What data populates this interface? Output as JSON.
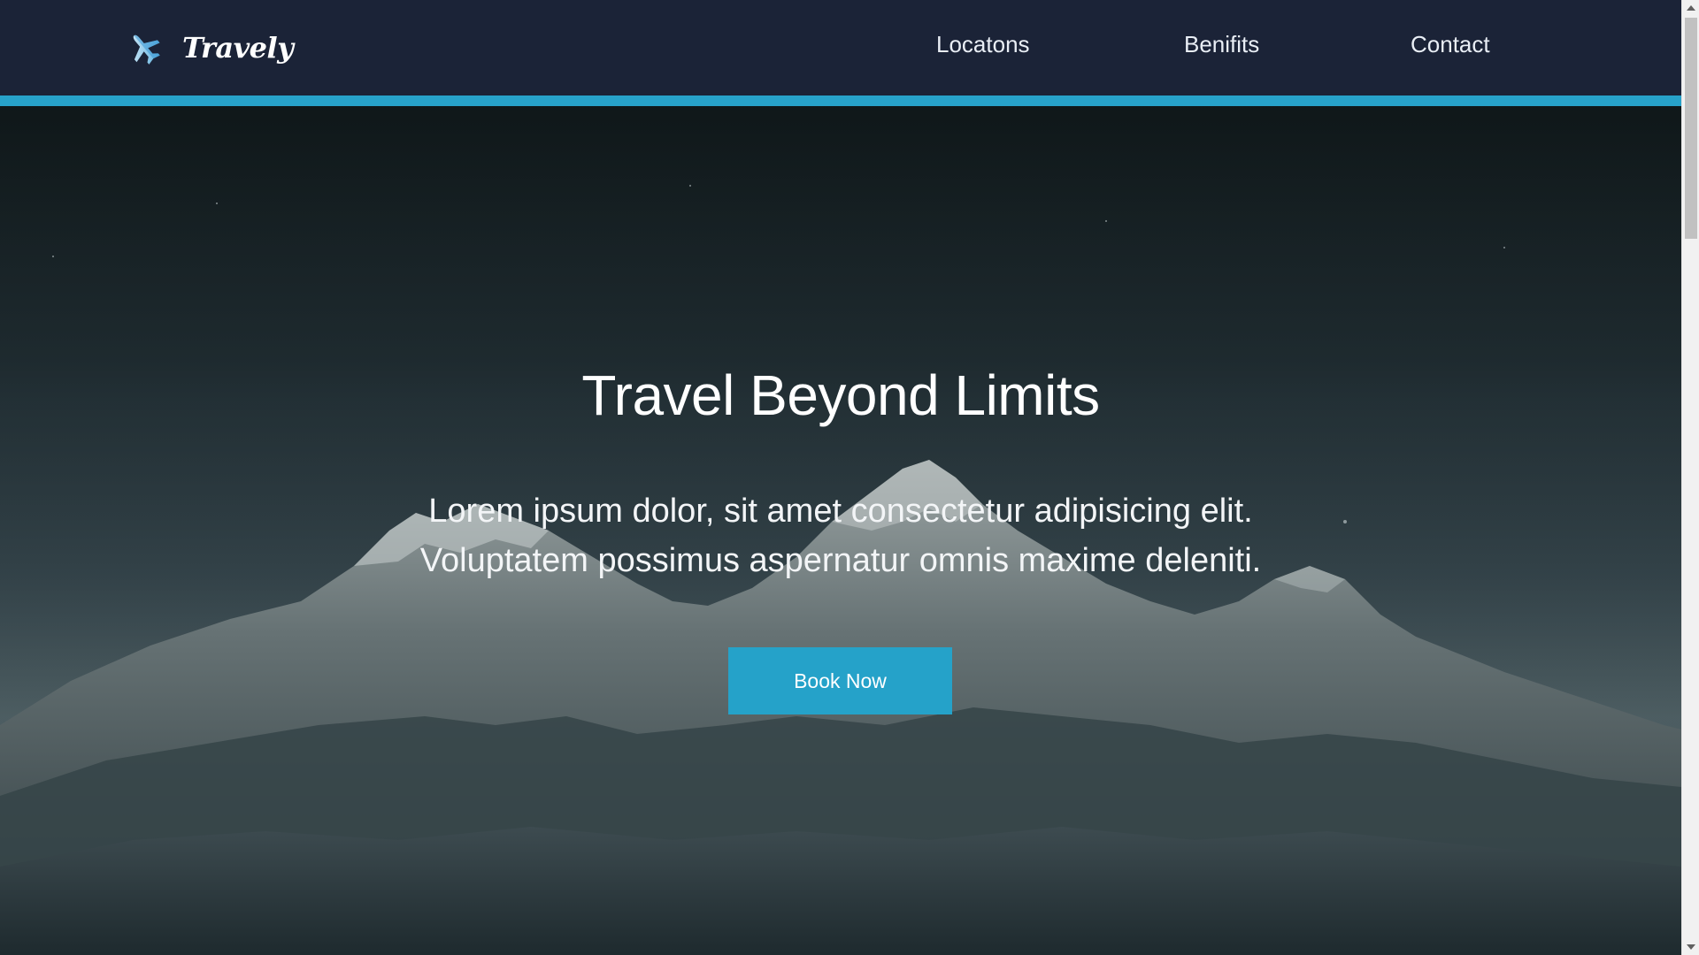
{
  "header": {
    "brand_name": "Travely",
    "logo_icon": "airplane-icon",
    "nav": [
      {
        "label": "Locatons"
      },
      {
        "label": "Benifits"
      },
      {
        "label": "Contact"
      }
    ]
  },
  "hero": {
    "title": "Travel Beyond Limits",
    "subtitle": "Lorem ipsum dolor, sit amet consectetur adipisicing elit. Voluptatem possimus aspernatur omnis maxime deleniti.",
    "cta_label": "Book Now",
    "background": "mountain-night-photo"
  },
  "colors": {
    "header_bg": "#1b2337",
    "accent": "#27a2ca",
    "button": "#25a2c9",
    "text": "#ffffff"
  }
}
